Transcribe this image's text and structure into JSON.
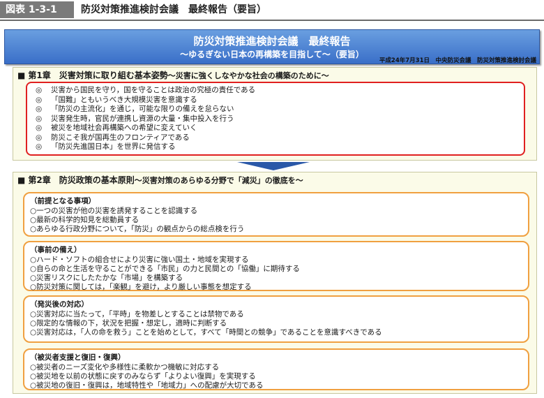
{
  "figure": {
    "tag": "図表 1-3-1",
    "title": "防災対策推進検討会議　最終報告（要旨）"
  },
  "banner": {
    "title": "防災対策推進検討会議　最終報告",
    "subtitle": "～ゆるぎない日本の再構築を目指して～（要旨）",
    "date": "平成24年7月31日　中央防災会議　防災対策推進検討会議"
  },
  "chapter1": {
    "marker": "■",
    "title": "第1章　災害対策に取り組む基本姿勢",
    "subtitle": "～災害に強くしなやかな社会の構築のために～",
    "marker_item": "◎",
    "items": [
      "災害から国民を守り，国を守ることは政治の究極の責任である",
      "「国難」ともいうべき大規模災害を意識する",
      "「防災の主流化」を通じ，可能な限りの備えを怠らない",
      "災害発生時，官民が連携し資源の大量・集中投入を行う",
      "被災を地域社会再構築への希望に変えていく",
      "防災こそ我が国再生のフロンティアである",
      "「防災先進国日本」を世界に発信する"
    ]
  },
  "chapter2": {
    "marker": "■",
    "title": "第2章　防災政策の基本原則",
    "subtitle": "～災害対策のあらゆる分野で「減災」の徹底を～",
    "sections": [
      {
        "title": "（前提となる事項）",
        "items": [
          "○一つの災害が他の災害を誘発することを認識する",
          "○最新の科学的知見を総動員する",
          "○あらゆる行政分野について，「防災」の観点からの総点検を行う"
        ]
      },
      {
        "title": "（事前の備え）",
        "items": [
          "○ハード・ソフトの組合せにより災害に強い国土・地域を実現する",
          "○自らの命と生活を守ることができる「市民」の力と民間との「協働」に期待する",
          "○災害リスクにしたたかな「市場」を構築する",
          "○防災対策に関しては，「楽観」を避け，より厳しい事態を想定する"
        ]
      },
      {
        "title": "（発災後の対応）",
        "items": [
          "○災害対応に当たって，「平時」を物差しとすることは禁物である",
          "○限定的な情報の下，状況を把握・想定し，適時に判断する",
          "○災害対応は，「人の命を救う」ことを始めとして，すべて「時間との競争」であることを意識すべきである"
        ]
      },
      {
        "title": "（被災者支援と復旧・復興）",
        "items": [
          "○被災者のニーズ変化や多様性に柔軟かつ機敏に対応する",
          "○被災地を以前の状態に戻すのみならず「よりよい復興」を実現する",
          "○被災地の復旧・復興は，地域特性や「地域力」への配慮が大切である"
        ]
      }
    ]
  }
}
